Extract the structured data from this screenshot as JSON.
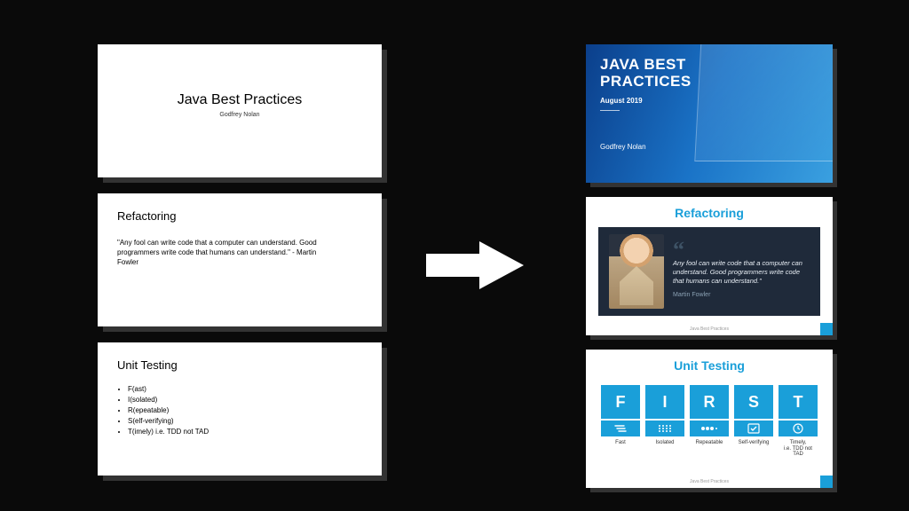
{
  "left": {
    "title_slide": {
      "title": "Java Best Practices",
      "author": "Godfrey Nolan"
    },
    "refactoring_slide": {
      "heading": "Refactoring",
      "quote": "\"Any fool can write code that a computer can understand. Good programmers write code that humans can understand.\" - Martin Fowler"
    },
    "unit_slide": {
      "heading": "Unit Testing",
      "bullets": [
        "F(ast)",
        "I(solated)",
        "R(epeatable)",
        "S(elf-verifying)",
        "T(imely) i.e. TDD not TAD"
      ]
    }
  },
  "right": {
    "hero": {
      "title_line1": "JAVA BEST",
      "title_line2": "PRACTICES",
      "date": "August 2019",
      "author": "Godfrey Nolan"
    },
    "refactoring": {
      "heading": "Refactoring",
      "quote": "Any fool can write code that a computer can understand. Good programmers write code that humans can understand.\"",
      "author": "Martin Fowler",
      "footer": "Java Best Practices"
    },
    "unit": {
      "heading": "Unit Testing",
      "items": [
        {
          "letter": "F",
          "label": "Fast"
        },
        {
          "letter": "I",
          "label": "Isolated"
        },
        {
          "letter": "R",
          "label": "Repeatable"
        },
        {
          "letter": "S",
          "label": "Self-verifying"
        },
        {
          "letter": "T",
          "label": "Timely,\ni.e. TDD not TAD"
        }
      ],
      "footer": "Java Best Practices"
    }
  }
}
